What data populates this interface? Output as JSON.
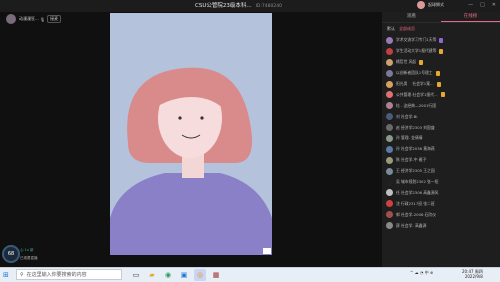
{
  "window": {
    "title": "CSU公管院23级本科...",
    "subtitle": "ID:7480240",
    "user_name": "起球狮式",
    "controls": [
      "—",
      "□",
      "✕"
    ]
  },
  "host": {
    "name": "动漫漫狂...",
    "listen_label": "接麦"
  },
  "panel": {
    "tabs": [
      "观看",
      "在线榜"
    ],
    "active_tab": 1,
    "filter": {
      "label": "默认",
      "selected": "全部成员"
    },
    "members": [
      {
        "name": "学术交流学习专门1天等",
        "color": "#9a7ab5",
        "level": "#8a6ad0"
      },
      {
        "name": "学生活动大学1报代建等",
        "color": "#c04040",
        "level": "#e7a830"
      },
      {
        "name": "橘哲世 风起",
        "color": "#d0a070",
        "level": "#e7a830"
      },
      {
        "name": "以创新者团队1号理工",
        "color": "#7a7a9a",
        "level": "#e7a830"
      },
      {
        "name": "阳光男 　社会学1案...",
        "color": "#d8a060",
        "level": "#e7a830"
      },
      {
        "name": "公共管理-社会学1报代...",
        "color": "#e07070",
        "level": "#e7a830"
      },
      {
        "name": "桂 - 这经典—2001行国",
        "color": "#b08090",
        "level": ""
      },
      {
        "name": "刘 社会学-Bi",
        "color": "#4a5a7a",
        "level": ""
      },
      {
        "name": "赵 经济学2303 刘国盛",
        "color": "#6a6a6a",
        "level": ""
      },
      {
        "name": "孙 管理- 金倩倩",
        "color": "#8a9a8a",
        "level": ""
      },
      {
        "name": "孙 社会学2036 黄海燕",
        "color": "#5a7aaa",
        "level": ""
      },
      {
        "name": "陈 社会学-中 雁子",
        "color": "#9a9a7a",
        "level": ""
      },
      {
        "name": "王 经济学2305 王之园",
        "color": "#7a8a9a",
        "level": ""
      },
      {
        "name": "吴 城市规划2302 张一阳",
        "color": "#202020",
        "level": ""
      },
      {
        "name": "任 社会学2306 高鑫源风",
        "color": "#c0c0c0",
        "level": ""
      },
      {
        "name": "沈 行政2317班 张二班",
        "color": "#d04040",
        "level": ""
      },
      {
        "name": "郭 社会学-2006 石欣仪",
        "color": "#a05050",
        "level": ""
      },
      {
        "name": "薛 社会学- 高鑫源",
        "color": "#8a8a8a",
        "level": ""
      }
    ]
  },
  "bottom_left": {
    "badge": "68",
    "text1": "心 1x 新",
    "text2": "已观看直播"
  },
  "taskbar": {
    "search_placeholder": "在这里输入你要搜索的内容",
    "apps": [
      {
        "glyph": "▭",
        "color": "#333",
        "bg": "transparent"
      },
      {
        "glyph": "▰",
        "color": "#e7a830",
        "bg": "transparent"
      },
      {
        "glyph": "◉",
        "color": "#2a9d5a",
        "bg": "transparent"
      },
      {
        "glyph": "▣",
        "color": "#1e7ad6",
        "bg": "transparent"
      },
      {
        "glyph": "◎",
        "color": "#ff7a2a",
        "bg": "#c8d6f0"
      },
      {
        "glyph": "▦",
        "color": "#a03030",
        "bg": "transparent"
      }
    ],
    "tray": "^ ☁ ◔ 中 ⊕",
    "time": "20:47 周四",
    "date": "2022/9/8"
  }
}
